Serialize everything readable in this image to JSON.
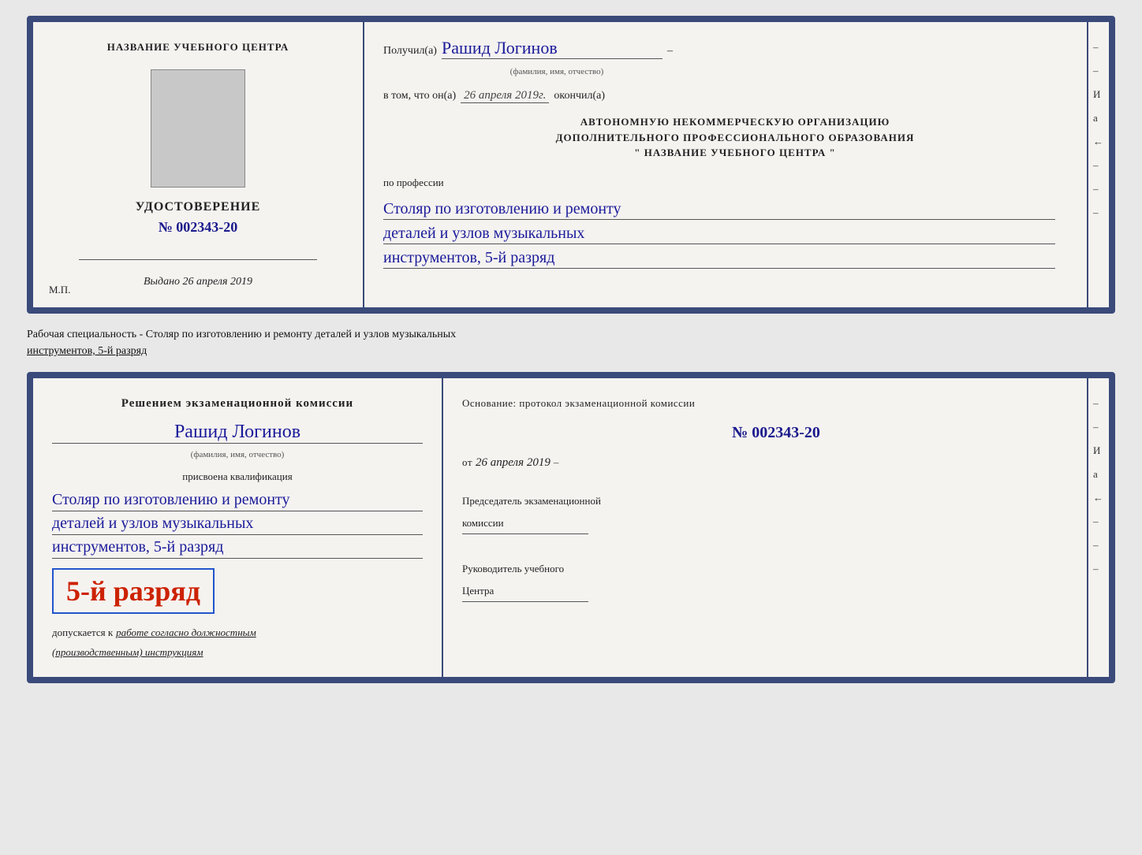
{
  "cert1": {
    "left": {
      "title": "НАЗВАНИЕ УЧЕБНОГО ЦЕНТРА",
      "photo_alt": "photo",
      "udostoverenie": "УДОСТОВЕРЕНИЕ",
      "number_label": "№",
      "number": "002343-20",
      "vydano_label": "Выдано",
      "vydano_date": "26 апреля 2019",
      "mp": "М.П."
    },
    "right": {
      "poluchil_label": "Получил(а)",
      "name_handwritten": "Рашид Логинов",
      "name_subtitle": "(фамилия, имя, отчество)",
      "name_dash": "–",
      "vtom_label": "в том, что он(а)",
      "vtom_date": "26 апреля 2019г.",
      "okonchil_label": "окончил(а)",
      "org_line1": "АВТОНОМНУЮ НЕКОММЕРЧЕСКУЮ ОРГАНИЗАЦИЮ",
      "org_line2": "ДОПОЛНИТЕЛЬНОГО ПРОФЕССИОНАЛЬНОГО ОБРАЗОВАНИЯ",
      "org_line3": "\"  НАЗВАНИЕ УЧЕБНОГО ЦЕНТРА  \"",
      "po_professii": "по профессии",
      "profession_line1": "Столяр по изготовлению и ремонту",
      "profession_line2": "деталей и узлов музыкальных",
      "profession_line3": "инструментов, 5-й разряд",
      "edge_letters": [
        "И",
        "а",
        "←",
        "–",
        "–",
        "–",
        "–",
        "–"
      ]
    }
  },
  "specialty_text": {
    "prefix": "Рабочая специальность - Столяр по изготовлению и ремонту деталей и узлов музыкальных",
    "suffix_underline": "инструментов, 5-й разряд"
  },
  "cert2": {
    "left": {
      "heading": "Решением экзаменационной комиссии",
      "name_handwritten": "Рашид Логинов",
      "name_subtitle": "(фамилия, имя, отчество)",
      "prisvoena": "присвоена квалификация",
      "qual_line1": "Столяр по изготовлению и ремонту",
      "qual_line2": "деталей и узлов музыкальных",
      "qual_line3": "инструментов, 5-й разряд",
      "rank_text": "5-й разряд",
      "dopusk_prefix": "допускается к",
      "dopusk_italic": "работе согласно должностным",
      "dopusk_italic2": "(производственным) инструкциям"
    },
    "right": {
      "osnovanie_label": "Основание: протокол экзаменационной  комиссии",
      "number_label": "№",
      "number": "002343-20",
      "ot_label": "от",
      "ot_date": "26 апреля 2019",
      "predsedatel_label": "Председатель экзаменационной",
      "predsedatel_label2": "комиссии",
      "rukovoditel_label": "Руководитель учебного",
      "rukovoditel_label2": "Центра",
      "edge_letters": [
        "И",
        "а",
        "←",
        "–",
        "–",
        "–",
        "–",
        "–"
      ]
    }
  }
}
